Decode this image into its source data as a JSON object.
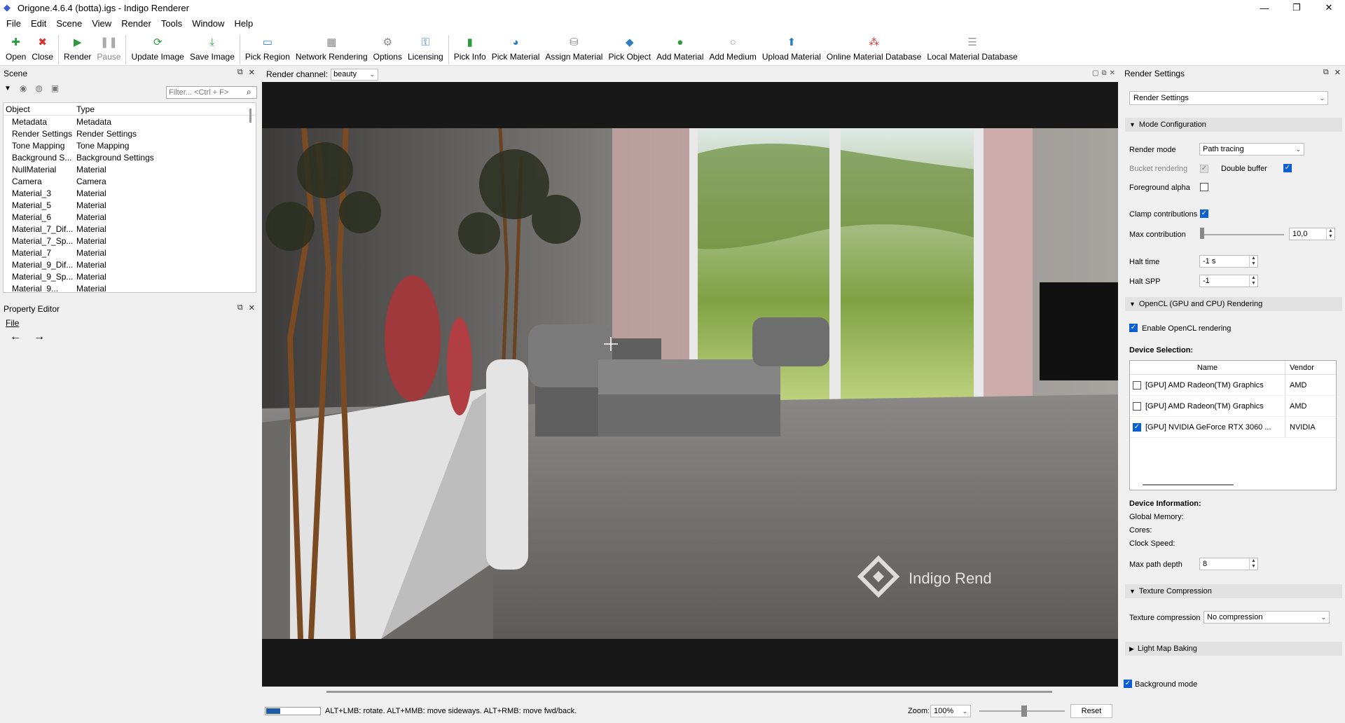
{
  "window": {
    "title": "Origone.4.6.4 (botta).igs - Indigo Renderer"
  },
  "menu": [
    "File",
    "Edit",
    "Scene",
    "View",
    "Render",
    "Tools",
    "Window",
    "Help"
  ],
  "toolbar": [
    {
      "label": "Open",
      "icon": "plus-icon",
      "color": "#2e9b3a",
      "disabled": false
    },
    {
      "label": "Close",
      "icon": "close-icon",
      "color": "#d9302c",
      "disabled": false
    },
    {
      "label": "Render",
      "icon": "play-icon",
      "color": "#2e9b3a",
      "disabled": false
    },
    {
      "label": "Pause",
      "icon": "pause-icon",
      "color": "#aaaaaa",
      "disabled": true
    },
    {
      "label": "Update Image",
      "icon": "refresh-icon",
      "color": "#2e9b3a",
      "disabled": false
    },
    {
      "label": "Save Image",
      "icon": "download-icon",
      "color": "#2e9b3a",
      "disabled": false
    },
    {
      "label": "Pick Region",
      "icon": "region-icon",
      "color": "#2a7fc4",
      "disabled": false
    },
    {
      "label": "Network Rendering",
      "icon": "network-icon",
      "color": "#888888",
      "disabled": false
    },
    {
      "label": "Options",
      "icon": "gear-icon",
      "color": "#888888",
      "disabled": false
    },
    {
      "label": "Licensing",
      "icon": "key-icon",
      "color": "#2a7fc4",
      "disabled": false
    },
    {
      "label": "Pick Info",
      "icon": "barchart-icon",
      "color": "#2e9b3a",
      "disabled": false
    },
    {
      "label": "Pick Material",
      "icon": "material-icon",
      "color": "#2a7fc4",
      "disabled": false
    },
    {
      "label": "Assign Material",
      "icon": "bucket-icon",
      "color": "#888888",
      "disabled": false
    },
    {
      "label": "Pick Object",
      "icon": "object-icon",
      "color": "#2a7fc4",
      "disabled": false
    },
    {
      "label": "Add Material",
      "icon": "add-material-icon",
      "color": "#2e9b3a",
      "disabled": false
    },
    {
      "label": "Add Medium",
      "icon": "medium-icon",
      "color": "#999999",
      "disabled": false
    },
    {
      "label": "Upload Material",
      "icon": "upload-icon",
      "color": "#2a7fc4",
      "disabled": false
    },
    {
      "label": "Online Material Database",
      "icon": "database-icon",
      "color": "#d9302c",
      "disabled": false
    },
    {
      "label": "Local Material Database",
      "icon": "list-icon",
      "color": "#999999",
      "disabled": false
    }
  ],
  "scene": {
    "title": "Scene",
    "filter_placeholder": "Filter... <Ctrl + F>",
    "columns": [
      "Object",
      "Type"
    ],
    "rows": [
      [
        "Metadata",
        "Metadata"
      ],
      [
        "Render Settings",
        "Render Settings"
      ],
      [
        "Tone Mapping",
        "Tone Mapping"
      ],
      [
        "Background S...",
        "Background Settings"
      ],
      [
        "NullMaterial",
        "Material"
      ],
      [
        "Camera",
        "Camera"
      ],
      [
        "Material_3",
        "Material"
      ],
      [
        "Material_5",
        "Material"
      ],
      [
        "Material_6",
        "Material"
      ],
      [
        "Material_7_Dif...",
        "Material"
      ],
      [
        "Material_7_Sp...",
        "Material"
      ],
      [
        "Material_7",
        "Material"
      ],
      [
        "Material_9_Dif...",
        "Material"
      ],
      [
        "Material_9_Sp...",
        "Material"
      ],
      [
        "Material_9...",
        "Material"
      ]
    ]
  },
  "property_editor": {
    "title": "Property Editor",
    "file_label": "File",
    "back": "←",
    "forward": "→"
  },
  "viewport": {
    "channel_label": "Render channel:",
    "channel_value": "beauty",
    "watermark": "Indigo Rend",
    "status_text": "ALT+LMB: rotate. ALT+MMB: move sideways. ALT+RMB: move fwd/back.",
    "progress": 0.25,
    "zoom_label": "Zoom:",
    "zoom_value": "100%",
    "reset_label": "Reset"
  },
  "render_settings": {
    "title": "Render Settings",
    "preset": "Render Settings",
    "mode_section": "Mode Configuration",
    "render_mode_label": "Render mode",
    "render_mode_value": "Path tracing",
    "bucket_label": "Bucket rendering",
    "bucket_checked": true,
    "double_buffer_label": "Double buffer",
    "double_buffer_checked": true,
    "fg_alpha_label": "Foreground alpha",
    "fg_alpha_checked": false,
    "clamp_label": "Clamp contributions",
    "clamp_checked": true,
    "max_contrib_label": "Max contribution",
    "max_contrib_value": "10,0",
    "halt_time_label": "Halt time",
    "halt_time_value": "-1 s",
    "halt_spp_label": "Halt SPP",
    "halt_spp_value": "-1",
    "opencl_section": "OpenCL (GPU and CPU) Rendering",
    "enable_opencl_label": "Enable OpenCL rendering",
    "enable_opencl_checked": true,
    "device_selection_label": "Device Selection:",
    "device_columns": [
      "Name",
      "Vendor"
    ],
    "devices": [
      {
        "name": "[GPU] AMD Radeon(TM) Graphics",
        "vendor": "AMD",
        "checked": false
      },
      {
        "name": "[GPU] AMD Radeon(TM) Graphics",
        "vendor": "AMD",
        "checked": false
      },
      {
        "name": "[GPU] NVIDIA GeForce RTX 3060 ...",
        "vendor": "NVIDIA",
        "checked": true
      }
    ],
    "device_info_label": "Device Information:",
    "global_memory_label": "Global Memory:",
    "cores_label": "Cores:",
    "clock_speed_label": "Clock Speed:",
    "max_path_depth_label": "Max path depth",
    "max_path_depth_value": "8",
    "texture_section": "Texture Compression",
    "texture_label": "Texture compression",
    "texture_value": "No compression",
    "lightmap_section": "Light Map Baking",
    "background_mode_label": "Background mode",
    "background_mode_checked": true
  }
}
